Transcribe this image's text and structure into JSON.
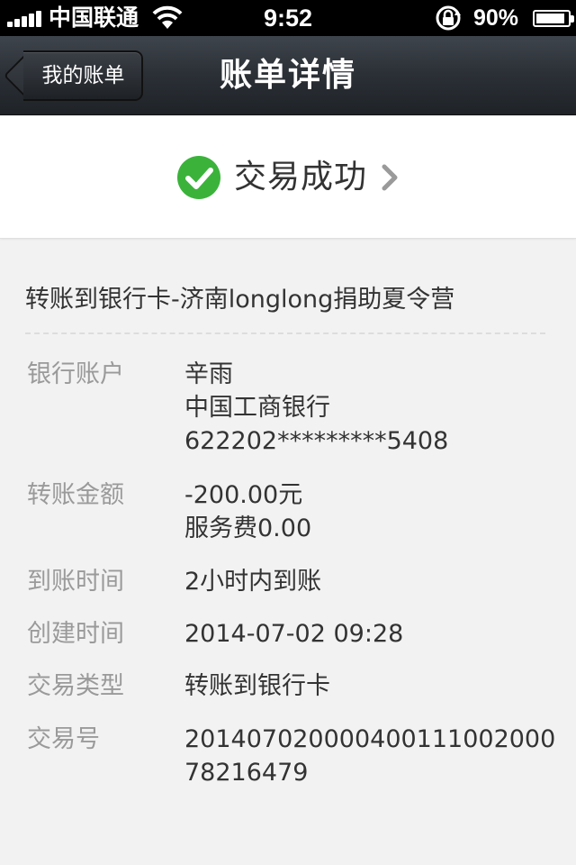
{
  "status_bar": {
    "carrier": "中国联通",
    "time": "9:52",
    "battery_percent": "90%",
    "battery_level": 0.9
  },
  "nav": {
    "back_label": "我的账单",
    "title": "账单详情"
  },
  "status": {
    "text": "交易成功"
  },
  "details": {
    "title": "转账到银行卡-济南longlong捐助夏令营",
    "bank_account": {
      "label": "银行账户",
      "name": "辛雨",
      "bank": "中国工商银行",
      "card": "622202*********5408"
    },
    "amount": {
      "label": "转账金额",
      "value": "-200.00元",
      "fee": "服务费0.00"
    },
    "arrival": {
      "label": "到账时间",
      "value": "2小时内到账"
    },
    "created": {
      "label": "创建时间",
      "value": "2014-07-02 09:28"
    },
    "type": {
      "label": "交易类型",
      "value": "转账到银行卡"
    },
    "trade_no": {
      "label": "交易号",
      "line1": "20140702000040011100200​0",
      "line2": "78216479"
    }
  },
  "colors": {
    "success_green": "#3bb33b",
    "nav_bg": "#2b3036",
    "label_gray": "#9a9a9a"
  }
}
